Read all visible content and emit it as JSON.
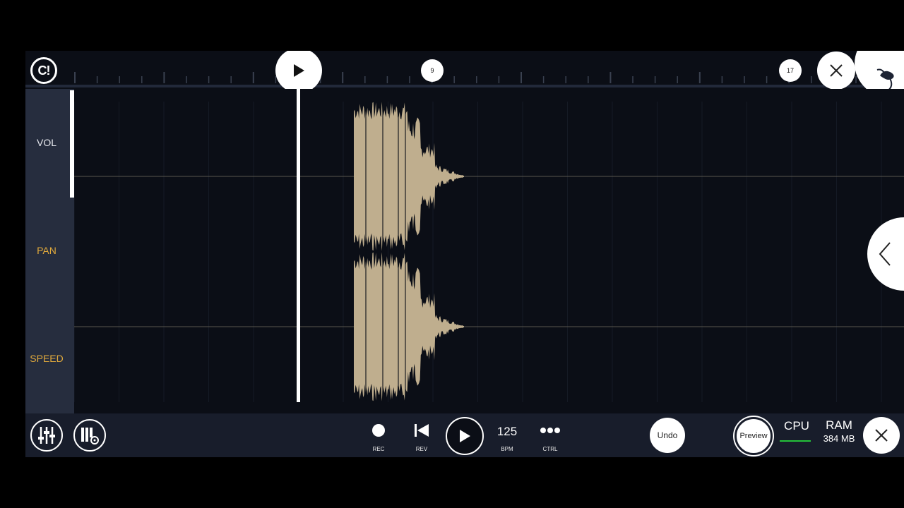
{
  "timeline": {
    "bar_markers": [
      "9",
      "17"
    ]
  },
  "sidebar": {
    "vol_label": "VOL",
    "pan_label": "PAN",
    "speed_label": "SPEED"
  },
  "transport": {
    "rec_label": "REC",
    "rev_label": "REV",
    "bpm_value": "125",
    "bpm_label": "BPM",
    "ctrl_label": "CTRL"
  },
  "actions": {
    "undo_label": "Undo",
    "preview_label": "Preview"
  },
  "status": {
    "cpu_label": "CPU",
    "ram_label": "RAM",
    "ram_value": "384 MB"
  },
  "icons": {
    "logo": "fl-logo-icon",
    "timeline_play": "play-icon",
    "close": "close-icon",
    "fruit": "fruit-icon",
    "mixer": "mixer-icon",
    "piano_settings": "piano-settings-icon",
    "rec": "record-dot-icon",
    "rev": "rewind-icon",
    "play": "play-icon",
    "ctrl": "ellipsis-icon",
    "side_toggle": "chevron-left-icon"
  },
  "colors": {
    "background": "#0b0e16",
    "sidebar": "#262d3e",
    "bottom_bar": "#181d2b",
    "waveform": "#bfae8e",
    "accent_label": "#e0a93c",
    "cpu_meter": "#24c23a"
  }
}
